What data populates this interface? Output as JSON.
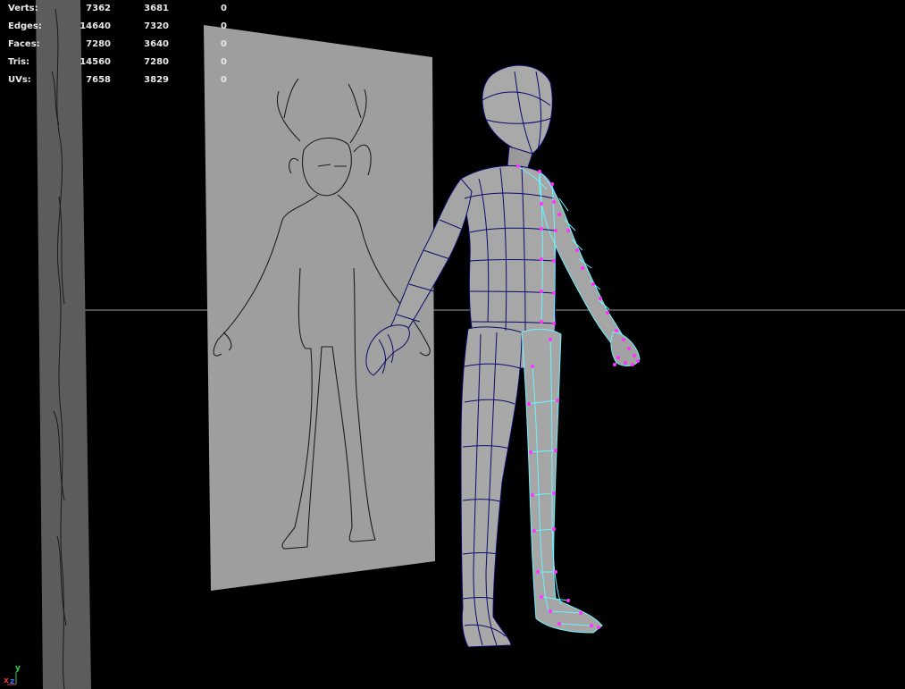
{
  "stats": [
    {
      "label": "Verts:",
      "total": "7362",
      "selected": "3681",
      "components": "0"
    },
    {
      "label": "Edges:",
      "total": "14640",
      "selected": "7320",
      "components": "0"
    },
    {
      "label": "Faces:",
      "total": "7280",
      "selected": "3640",
      "components": "0"
    },
    {
      "label": "Tris:",
      "total": "14560",
      "selected": "7280",
      "components": "0"
    },
    {
      "label": "UVs:",
      "total": "7658",
      "selected": "3829",
      "components": "0"
    }
  ],
  "axis": {
    "y": "y",
    "x": "x",
    "z": "z"
  },
  "colors": {
    "background": "#000000",
    "mesh_fill": "#a9a9a9",
    "wire": "#0b0b6b",
    "selected_wire": "#6ef3ff",
    "selected_vertex": "#ff33ff",
    "image_plane": "#9e9e9e",
    "grid_line": "#6a6a6a"
  },
  "icons": [
    "axis-gizmo-icon"
  ]
}
